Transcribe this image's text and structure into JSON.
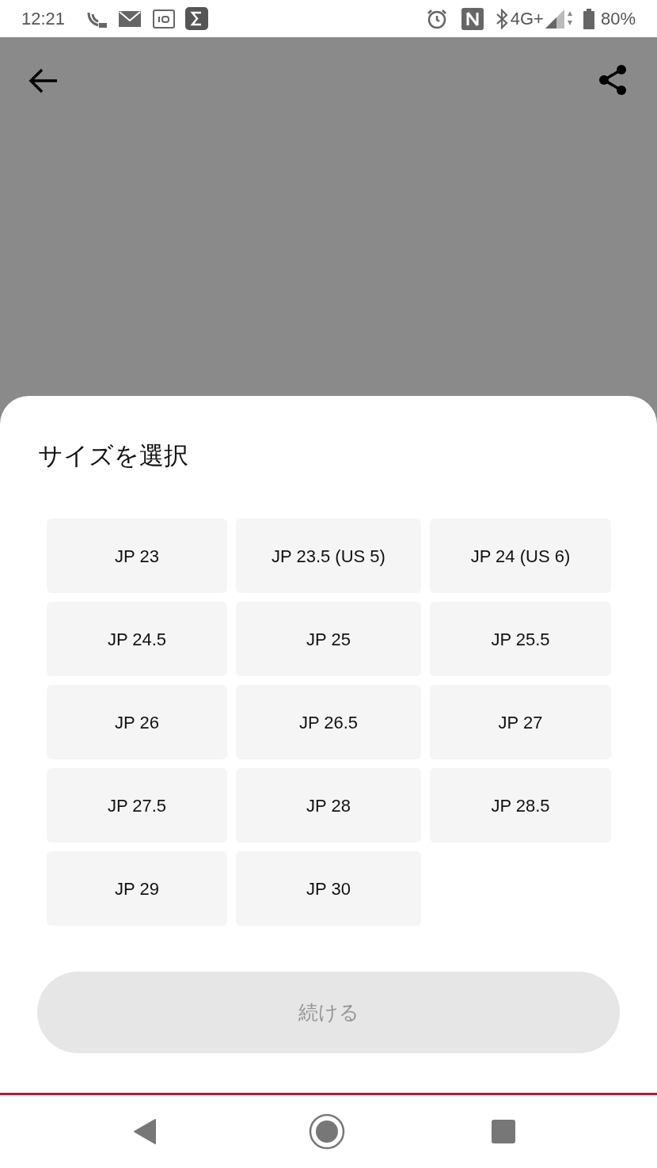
{
  "status_bar": {
    "time": "12:21",
    "network": "4G+",
    "battery": "80%"
  },
  "sheet": {
    "title": "サイズを選択",
    "sizes": [
      {
        "label": "JP 23",
        "selected": false
      },
      {
        "label": "JP 23.5 (US 5)",
        "selected": false
      },
      {
        "label": "JP 24 (US 6)",
        "selected": false
      },
      {
        "label": "JP 24.5",
        "selected": false
      },
      {
        "label": "JP 25",
        "selected": false
      },
      {
        "label": "JP 25.5",
        "selected": false
      },
      {
        "label": "JP 26",
        "selected": false
      },
      {
        "label": "JP 26.5",
        "selected": false
      },
      {
        "label": "JP 27",
        "selected": false
      },
      {
        "label": "JP 27.5",
        "selected": false
      },
      {
        "label": "JP 28",
        "selected": false
      },
      {
        "label": "JP 28.5",
        "selected": false
      },
      {
        "label": "JP 29",
        "selected": false
      },
      {
        "label": "JP 30",
        "selected": false
      }
    ],
    "continue_button": {
      "label": "続ける",
      "disabled": true
    }
  }
}
